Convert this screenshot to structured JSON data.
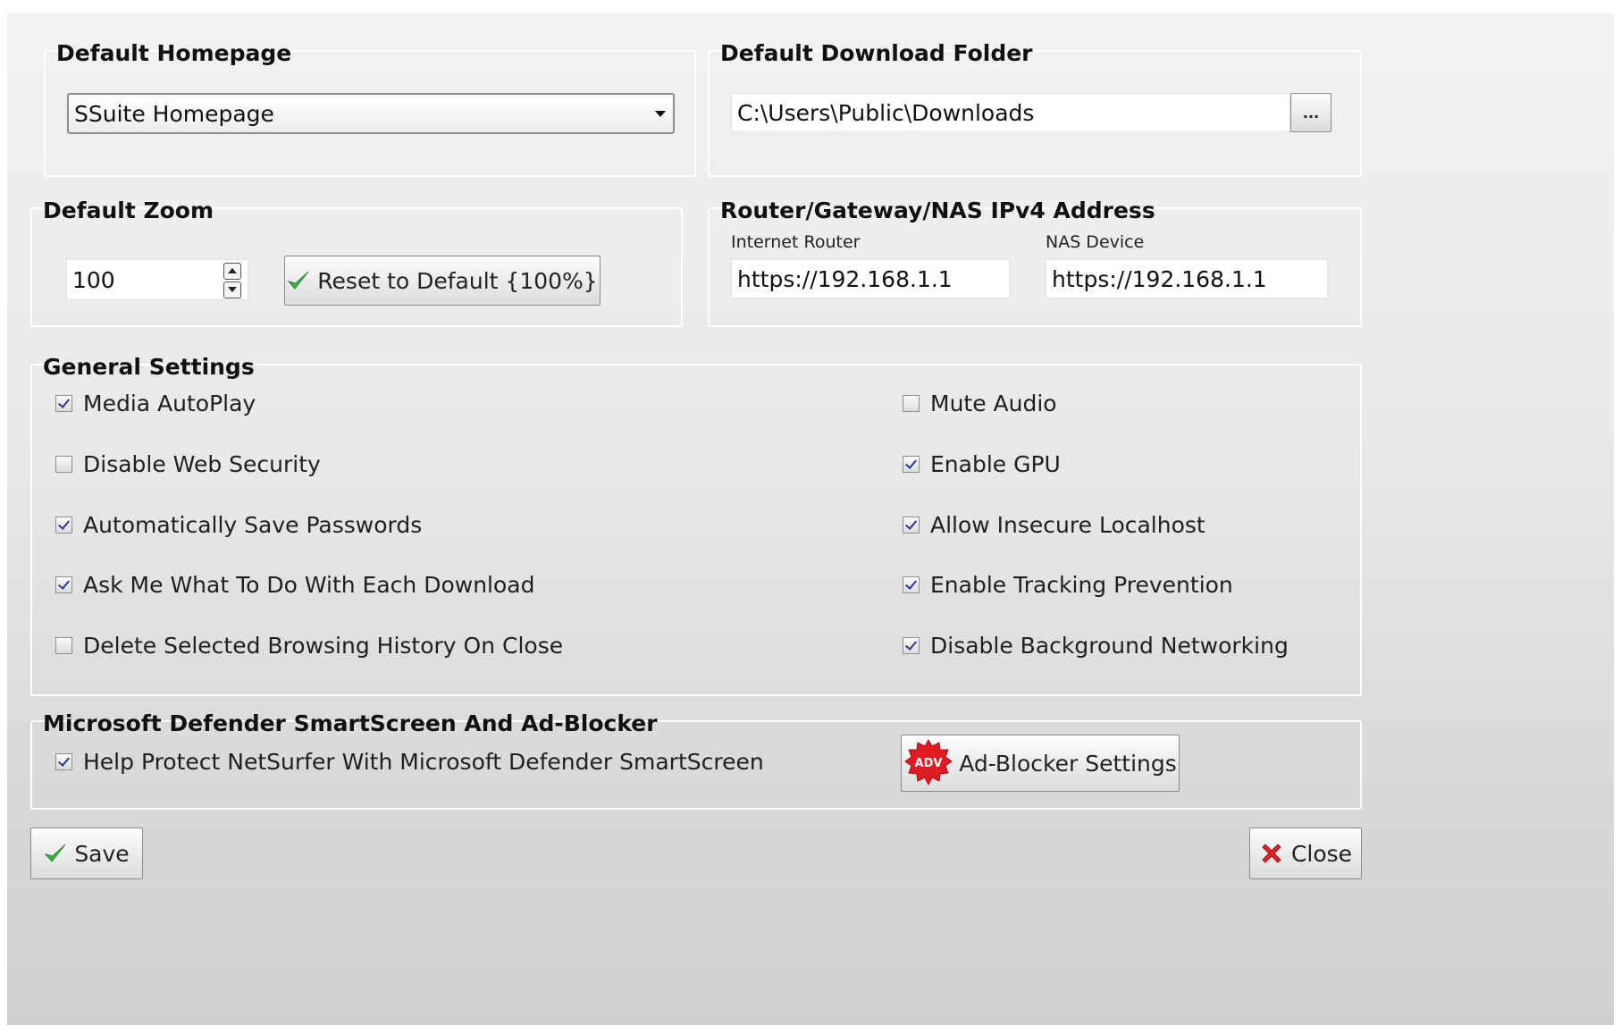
{
  "homepage": {
    "title": "Default Homepage",
    "selected": "SSuite Homepage"
  },
  "download": {
    "title": "Default Download Folder",
    "path": "C:\\Users\\Public\\Downloads",
    "browse_label": "..."
  },
  "zoom": {
    "title": "Default Zoom",
    "value": "100",
    "reset_label": "Reset to Default {100%}"
  },
  "router": {
    "title": "Router/Gateway/NAS IPv4 Address",
    "internet_label": "Internet Router",
    "internet_value": "https://192.168.1.1",
    "nas_label": "NAS Device",
    "nas_value": "https://192.168.1.1"
  },
  "general": {
    "title": "General Settings",
    "left": [
      {
        "label": "Media AutoPlay",
        "checked": true
      },
      {
        "label": "Disable Web Security",
        "checked": false
      },
      {
        "label": "Automatically Save Passwords",
        "checked": true
      },
      {
        "label": "Ask Me What To Do With Each Download",
        "checked": true
      },
      {
        "label": "Delete Selected Browsing History On Close",
        "checked": false
      }
    ],
    "right": [
      {
        "label": "Mute Audio",
        "checked": false
      },
      {
        "label": "Enable GPU",
        "checked": true
      },
      {
        "label": "Allow Insecure Localhost",
        "checked": true
      },
      {
        "label": "Enable Tracking Prevention",
        "checked": true
      },
      {
        "label": "Disable Background Networking",
        "checked": true
      }
    ]
  },
  "defender": {
    "title": "Microsoft Defender SmartScreen And Ad-Blocker",
    "smartscreen_label": "Help Protect NetSurfer With Microsoft Defender SmartScreen",
    "smartscreen_checked": true,
    "adblock_label": "Ad-Blocker Settings",
    "adv_badge": "ADV"
  },
  "footer": {
    "save_label": "Save",
    "close_label": "Close"
  },
  "colors": {
    "check_green": "#3cb043",
    "close_red": "#d9252c",
    "adv_red": "#e01b22"
  }
}
